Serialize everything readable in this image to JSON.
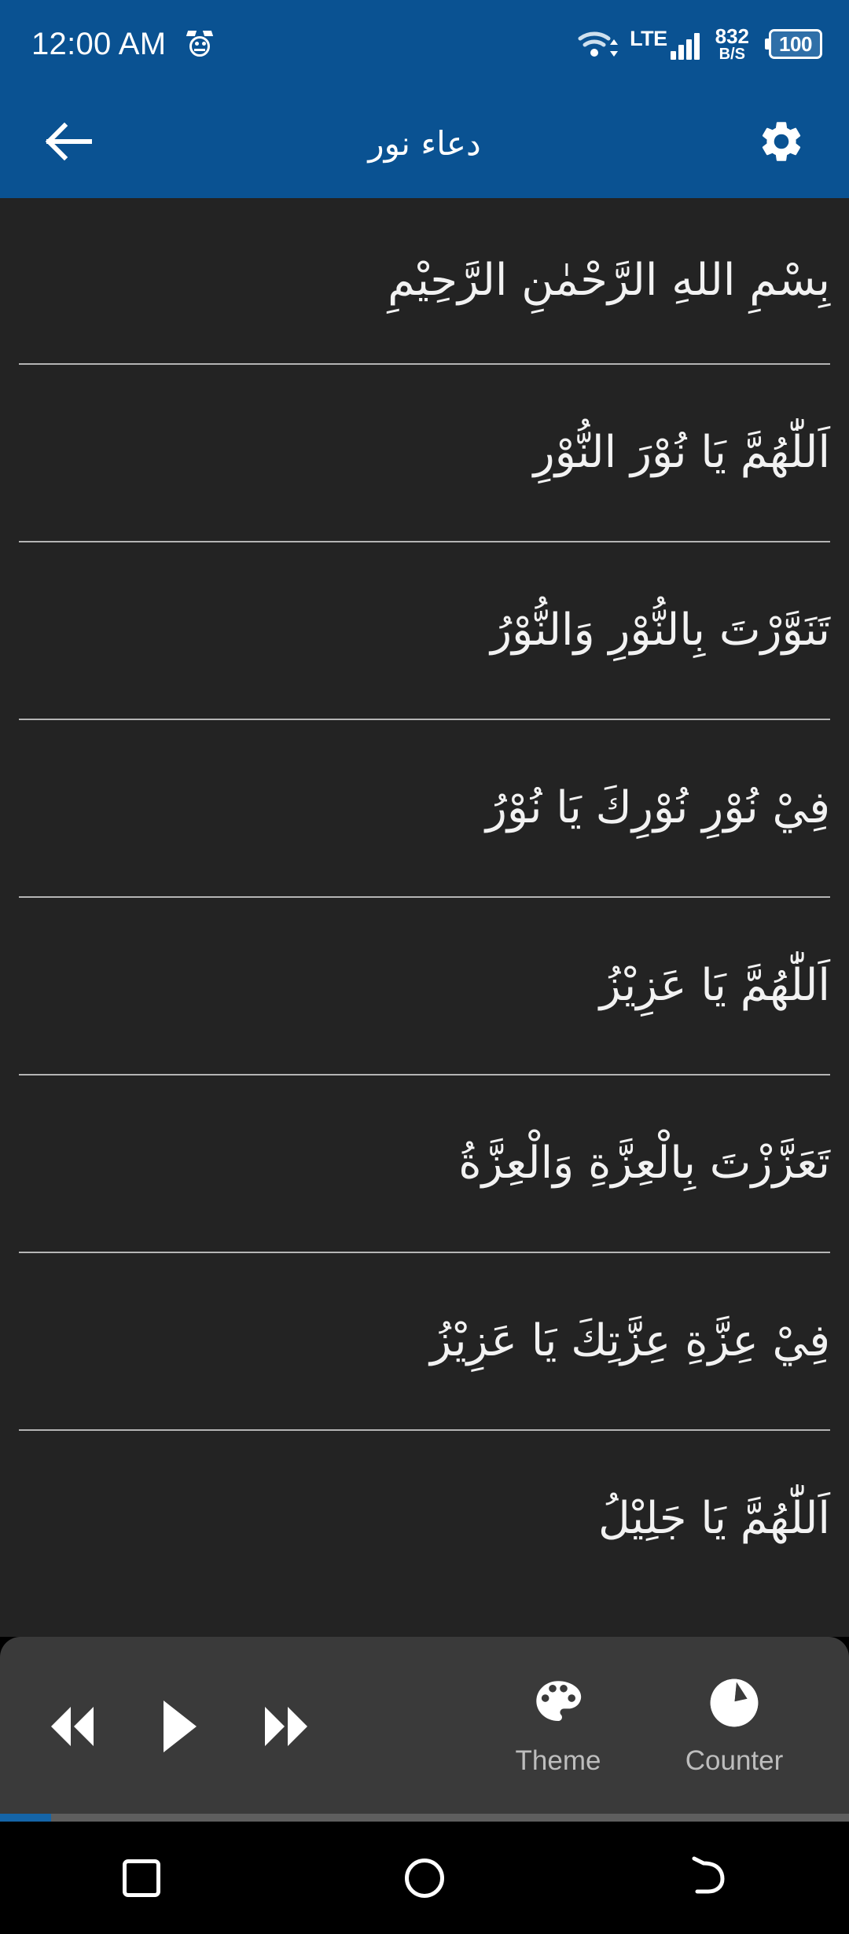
{
  "status_bar": {
    "time": "12:00 AM",
    "alarm_icon": "alarm-clock-icon",
    "wifi_icon": "wifi-icon",
    "network_type": "LTE",
    "signal_icon": "signal-bars-icon",
    "data_rate_value": "832",
    "data_rate_unit": "B/S",
    "battery_level": "100",
    "bg_color": "#0a5292"
  },
  "app_bar": {
    "back_icon": "back-arrow-icon",
    "title": "دعاء نور",
    "settings_icon": "gear-icon",
    "bg_color": "#0a5292"
  },
  "content": {
    "bg_color": "#232323",
    "text_color": "#f2f2f2",
    "lines": [
      {
        "text": "بِسْمِ اللهِ الرَّحْمٰنِ الرَّحِيْمِ"
      },
      {
        "text": "اَللّٰهُمَّ يَا نُوْرَ النُّوْرِ"
      },
      {
        "text": "تَنَوَّرْتَ بِالنُّوْرِ وَالنُّوْرُ"
      },
      {
        "text": "فِيْ نُوْرِ نُوْرِكَ يَا نُوْرُ"
      },
      {
        "text": "اَللّٰهُمَّ يَا عَزِيْزُ"
      },
      {
        "text": "تَعَزَّزْتَ بِالْعِزَّةِ وَالْعِزَّةُ"
      },
      {
        "text": "فِيْ عِزَّةِ عِزَّتِكَ يَا عَزِيْزُ"
      },
      {
        "text": "اَللّٰهُمَّ يَا جَلِيْلُ"
      }
    ]
  },
  "control_bar": {
    "bg_color": "#3a3a3a",
    "rewind_icon": "rewind-icon",
    "play_icon": "play-icon",
    "forward_icon": "fast-forward-icon",
    "theme_icon": "palette-icon",
    "theme_label": "Theme",
    "counter_icon": "counter-pie-icon",
    "counter_label": "Counter"
  },
  "progress": {
    "fill_percent": 6,
    "fill_color": "#1565a8",
    "track_color": "#5e5e5e"
  },
  "nav_bar": {
    "recents_icon": "square-recents-icon",
    "home_icon": "circle-home-icon",
    "back_icon": "back-curve-icon",
    "bg_color": "#000000"
  }
}
